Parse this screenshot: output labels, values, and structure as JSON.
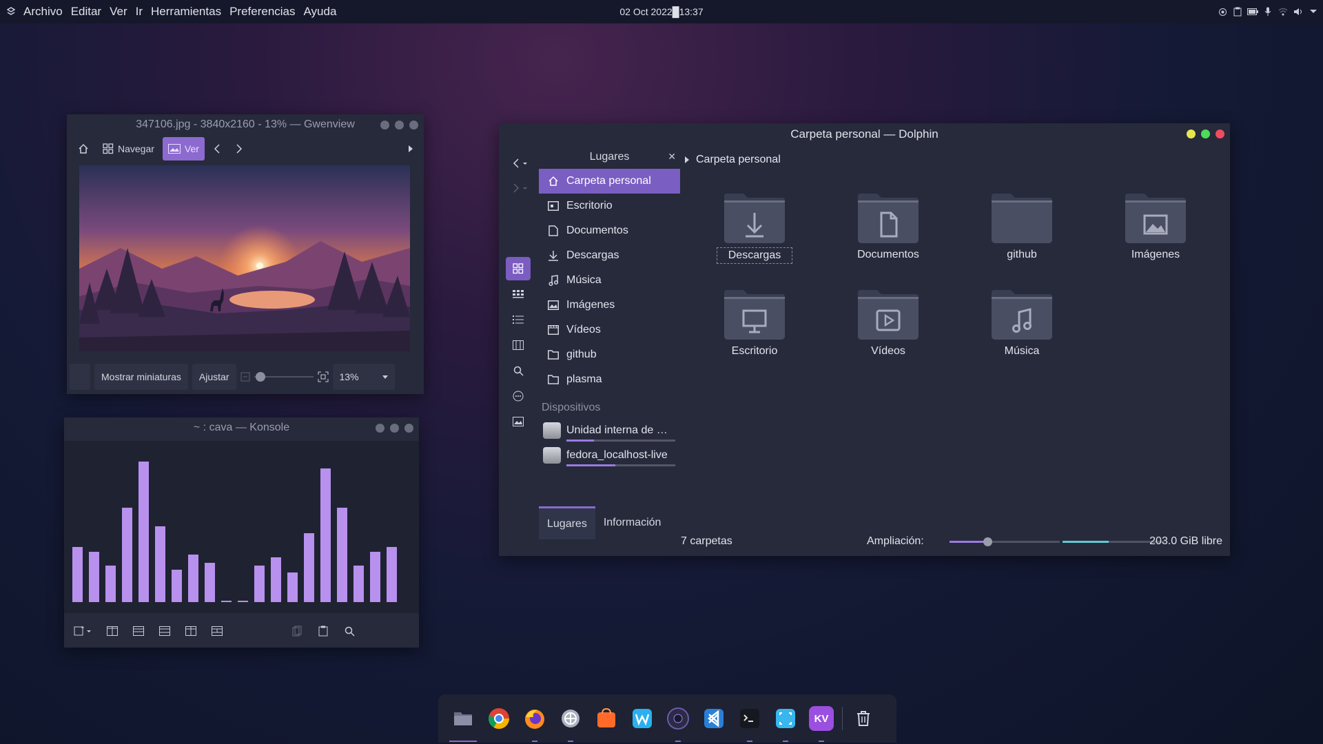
{
  "topbar": {
    "menu": [
      "Archivo",
      "Editar",
      "Ver",
      "Ir",
      "Herramientas",
      "Preferencias",
      "Ayuda"
    ],
    "clock": "02 Oct 2022█13:37",
    "tray_icons": [
      "screen-record-icon",
      "clipboard-icon",
      "battery-icon",
      "microphone-icon",
      "wifi-icon",
      "volume-icon",
      "chevron-down-icon"
    ]
  },
  "gwenview": {
    "title": "347106.jpg - 3840x2160 - 13% — Gwenview",
    "toolbar": {
      "browse_label": "Navegar",
      "view_label": "Ver"
    },
    "image_description_icon": "landscape-image",
    "statusbar": {
      "thumbnails_label": "Mostrar miniaturas",
      "fit_label": "Ajustar",
      "zoom_value": "13%"
    }
  },
  "konsole": {
    "title": "~ : cava — Konsole",
    "bar_levels": [
      0.39,
      0.36,
      0.26,
      0.67,
      1.0,
      0.54,
      0.23,
      0.34,
      0.28,
      0.01,
      0.01,
      0.26,
      0.32,
      0.21,
      0.49,
      0.95,
      0.67,
      0.26,
      0.36,
      0.39
    ],
    "bar_color": "#b890ee"
  },
  "dolphin": {
    "title": "Carpeta personal — Dolphin",
    "places_header": "Lugares",
    "places": [
      {
        "label": "Carpeta personal",
        "icon": "home-icon",
        "active": true
      },
      {
        "label": "Escritorio",
        "icon": "desktop-icon"
      },
      {
        "label": "Documentos",
        "icon": "document-icon"
      },
      {
        "label": "Descargas",
        "icon": "download-icon"
      },
      {
        "label": "Música",
        "icon": "music-icon"
      },
      {
        "label": "Imágenes",
        "icon": "image-icon"
      },
      {
        "label": "Vídeos",
        "icon": "video-icon"
      },
      {
        "label": "github",
        "icon": "folder-icon"
      },
      {
        "label": "plasma",
        "icon": "folder-icon"
      }
    ],
    "devices_header": "Dispositivos",
    "devices": [
      {
        "label": "Unidad interna de …",
        "usage": 0.25
      },
      {
        "label": "fedora_localhost-live",
        "usage": 0.45
      }
    ],
    "panel_tabs": [
      "Lugares",
      "Información"
    ],
    "breadcrumb": "Carpeta personal",
    "folders": [
      {
        "label": "Descargas",
        "icon": "download-icon"
      },
      {
        "label": "Documentos",
        "icon": "document-icon"
      },
      {
        "label": "github",
        "icon": "folder-icon"
      },
      {
        "label": "Imágenes",
        "icon": "image-icon"
      },
      {
        "label": "Escritorio",
        "icon": "desktop-icon"
      },
      {
        "label": "Vídeos",
        "icon": "video-icon"
      },
      {
        "label": "Música",
        "icon": "music-icon"
      }
    ],
    "status": {
      "count": "7 carpetas",
      "zoom_label": "Ampliación:",
      "zoom_level": 0.35,
      "space_used": 0.45,
      "free_space": "203.0 GiB libre"
    }
  },
  "dock": {
    "apps": [
      {
        "name": "file-manager-icon",
        "color": "#3a3e52"
      },
      {
        "name": "chrome-icon",
        "color": "#e8e8e8"
      },
      {
        "name": "firefox-icon",
        "color": "#ff8a1f"
      },
      {
        "name": "settings-icon",
        "color": "#c8ced8"
      },
      {
        "name": "software-store-icon",
        "color": "#ff7a2a"
      },
      {
        "name": "writer-icon",
        "color": "#3ab4f2"
      },
      {
        "name": "obs-icon",
        "color": "#2c2a44"
      },
      {
        "name": "vscode-icon",
        "color": "#2a7fd8"
      },
      {
        "name": "terminal-icon",
        "color": "#1a1c25"
      },
      {
        "name": "screenshot-icon",
        "color": "#38b6ef"
      },
      {
        "name": "kvantum-icon",
        "color": "#9b4fe0"
      },
      {
        "name": "trash-icon",
        "color": "#1e2233"
      }
    ],
    "kvantum_text": "KV"
  }
}
